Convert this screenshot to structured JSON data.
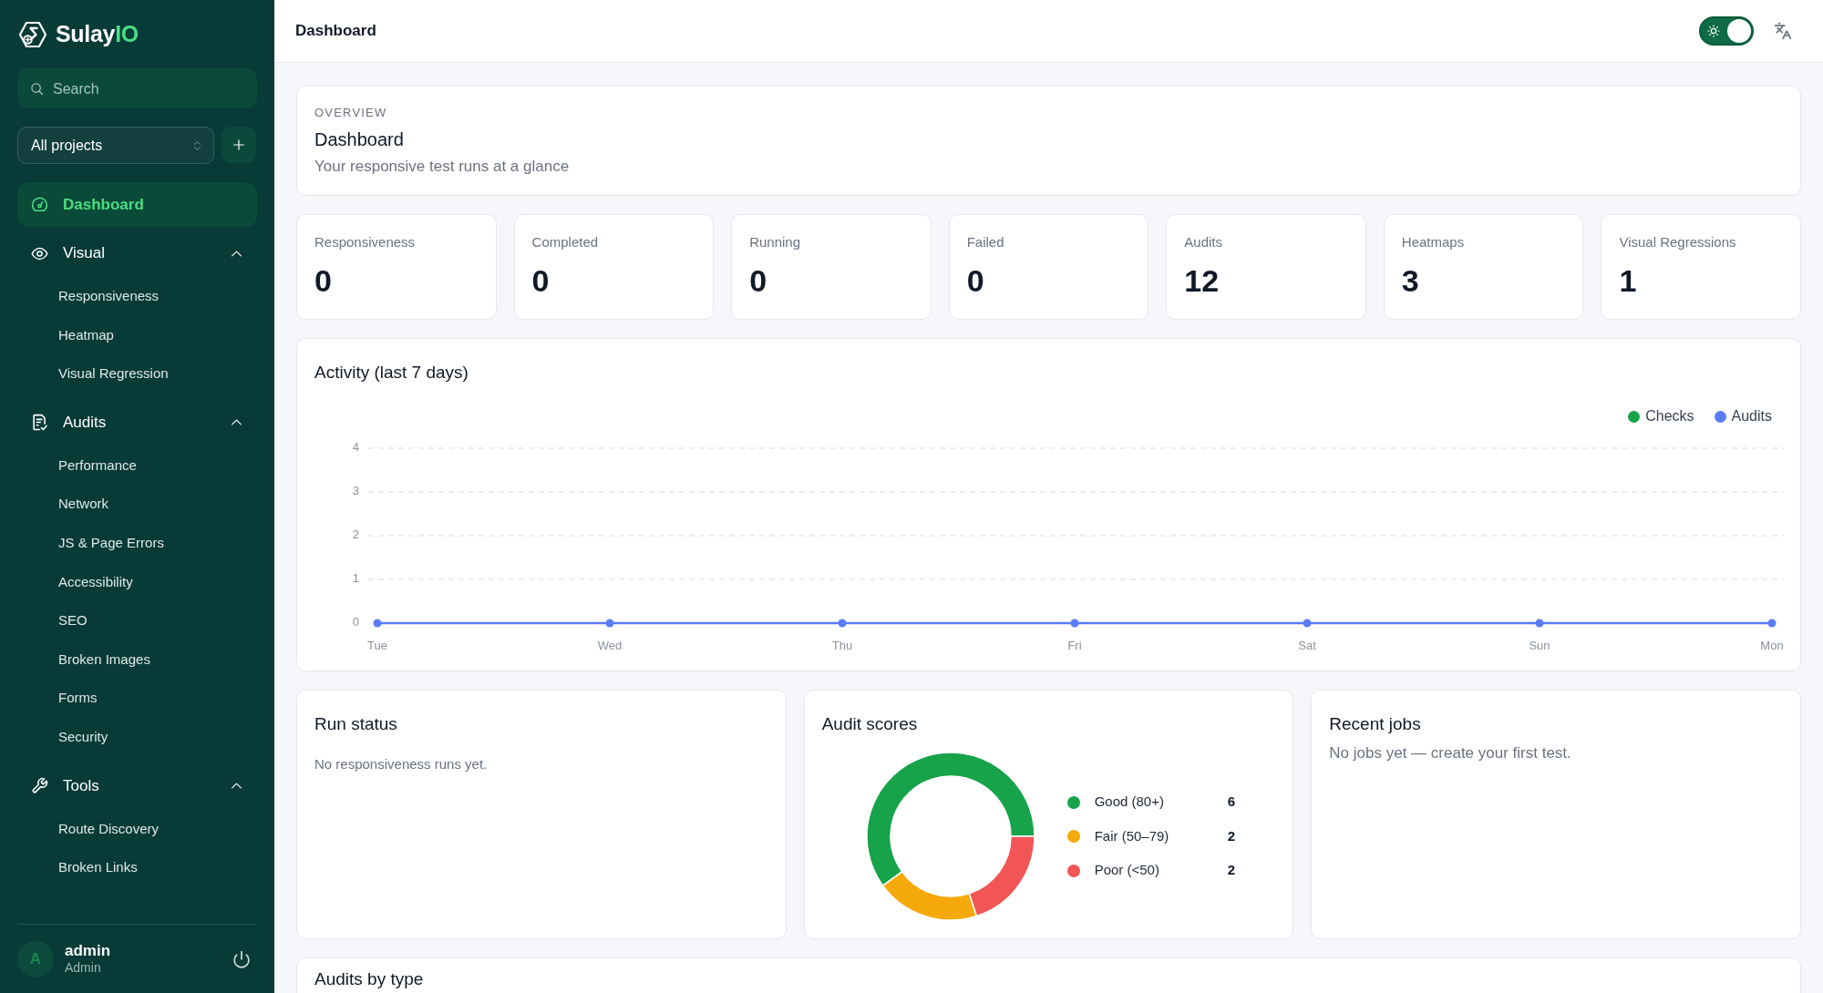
{
  "sidebar": {
    "brand": {
      "name": "Sulay",
      "accent": "IO"
    },
    "search": {
      "placeholder": "Search"
    },
    "project_select": {
      "value": "All projects"
    },
    "nav": [
      {
        "kind": "link",
        "label": "Dashboard",
        "selected": true
      },
      {
        "kind": "group",
        "label": "Visual",
        "expanded": true,
        "children": [
          {
            "label": "Responsiveness",
            "selected": false
          },
          {
            "label": "Heatmap",
            "selected": false
          },
          {
            "label": "Visual Regression",
            "selected": false
          }
        ]
      },
      {
        "kind": "group",
        "label": "Audits",
        "expanded": true,
        "children": [
          {
            "label": "Performance",
            "selected": false
          },
          {
            "label": "Network",
            "selected": false
          },
          {
            "label": "JS & Page Errors",
            "selected": false
          },
          {
            "label": "Accessibility",
            "selected": false
          },
          {
            "label": "SEO",
            "selected": false
          },
          {
            "label": "Broken Images",
            "selected": false
          },
          {
            "label": "Forms",
            "selected": false
          },
          {
            "label": "Security",
            "selected": false
          }
        ]
      },
      {
        "kind": "group",
        "label": "Tools",
        "expanded": true,
        "children": [
          {
            "label": "Route Discovery",
            "selected": false
          },
          {
            "label": "Broken Links",
            "selected": false
          }
        ]
      }
    ],
    "user": {
      "initial": "A",
      "name": "admin",
      "role": "Admin"
    }
  },
  "header": {
    "title": "Dashboard",
    "theme_toggle": {
      "on": true
    }
  },
  "overview": {
    "eyebrow": "OVERVIEW",
    "title": "Dashboard",
    "subtitle": "Your responsive test runs at a glance"
  },
  "stats": [
    {
      "label": "Responsiveness",
      "value": "0"
    },
    {
      "label": "Completed",
      "value": "0"
    },
    {
      "label": "Running",
      "value": "0"
    },
    {
      "label": "Failed",
      "value": "0"
    },
    {
      "label": "Audits",
      "value": "12"
    },
    {
      "label": "Heatmaps",
      "value": "3"
    },
    {
      "label": "Visual Regressions",
      "value": "1"
    }
  ],
  "activity": {
    "chart_data": {
      "type": "line",
      "title": "Activity (last 7 days)",
      "categories": [
        "Tue",
        "Wed",
        "Thu",
        "Fri",
        "Sat",
        "Sun",
        "Mon"
      ],
      "series": [
        {
          "name": "Checks",
          "color": "#16a34a",
          "marker": "circle",
          "values": [
            null,
            null,
            null,
            null,
            null,
            null,
            null
          ]
        },
        {
          "name": "Audits",
          "color": "#5b7cf5",
          "marker": "circle",
          "values": [
            0,
            0,
            0,
            0,
            0,
            0,
            0
          ]
        }
      ],
      "ylim": [
        0,
        4
      ],
      "yticks": [
        0,
        1,
        2,
        3,
        4
      ],
      "grid": true
    }
  },
  "run_status": {
    "title": "Run status",
    "message": "No responsiveness runs yet."
  },
  "audit_scores": {
    "title": "Audit scores",
    "legend": [
      {
        "count": "6",
        "color": "#16a34a"
      },
      {
        "count": "2",
        "color": "#f5a90b"
      },
      {
        "count": "2",
        "color": "#f25555"
      }
    ],
    "chart_data": {
      "type": "donut",
      "categories": [
        "Good (80+)",
        "Fair (50–79)",
        "Poor (<50)"
      ],
      "values": [
        60,
        20,
        20
      ]
    }
  },
  "recent_jobs": {
    "title": "Recent jobs",
    "message": "No jobs yet — create your first test."
  },
  "audits_by_type": {
    "title": "Audits by type"
  }
}
